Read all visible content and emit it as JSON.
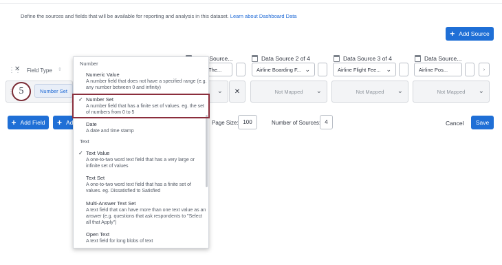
{
  "intro": {
    "text": "Define the sources and fields that will be available for reporting and analysis in this dataset.",
    "link": "Learn about Dashboard Data"
  },
  "toolbar": {
    "add_source_label": "Add Source"
  },
  "field_type": {
    "label": "Field Type"
  },
  "step_number": "5",
  "row": {
    "type_value": "Number Set"
  },
  "sources": [
    {
      "title": "Data Source...",
      "selected": "The...",
      "row_value": ""
    },
    {
      "title": "Data Source 2 of 4",
      "selected": "Airline Boarding F...",
      "row_value": "Not Mapped"
    },
    {
      "title": "Data Source 3 of 4",
      "selected": "Airline Flight Fee...",
      "row_value": "Not Mapped"
    },
    {
      "title": "Data Source...",
      "selected": "Airline Pos...",
      "row_value": "Not Mapped"
    }
  ],
  "bottom": {
    "add_field_label": "Add Field",
    "add_partial_label": "Ad",
    "page_size_label": "Page Size:",
    "page_size_value": "100",
    "num_sources_label": "Number of Sources:",
    "num_sources_value": "4",
    "cancel_label": "Cancel",
    "save_label": "Save"
  },
  "dropdown": {
    "groups": [
      {
        "label": "Number",
        "options": [
          {
            "title": "Numeric Value",
            "desc": "A number field that does not have a specified range (e.g. any number between 0 and infinity)",
            "checked": false
          },
          {
            "title": "Number Set",
            "desc": "A number field that has a finite set of values. eg. the set of numbers from 0 to 5",
            "checked": true
          },
          {
            "title": "Date",
            "desc": "A date and time stamp",
            "checked": false
          }
        ]
      },
      {
        "label": "Text",
        "options": [
          {
            "title": "Text Value",
            "desc": "A one-to-two word text field that has a very large or infinite set of values",
            "checked": true
          },
          {
            "title": "Text Set",
            "desc": "A one-to-two word text field that has a finite set of values. eg. Dissatisfied to Satisfied",
            "checked": false
          },
          {
            "title": "Multi-Answer Text Set",
            "desc": "A text field that can have more than one text value as an answer (e.g. questions that ask respondents to \"Select all that Apply\")",
            "checked": false
          },
          {
            "title": "Open Text",
            "desc": "A text field for long blobs of text",
            "checked": false
          }
        ]
      }
    ]
  },
  "colors": {
    "accent": "#1f6fd6",
    "highlight": "#8b2e3c"
  }
}
